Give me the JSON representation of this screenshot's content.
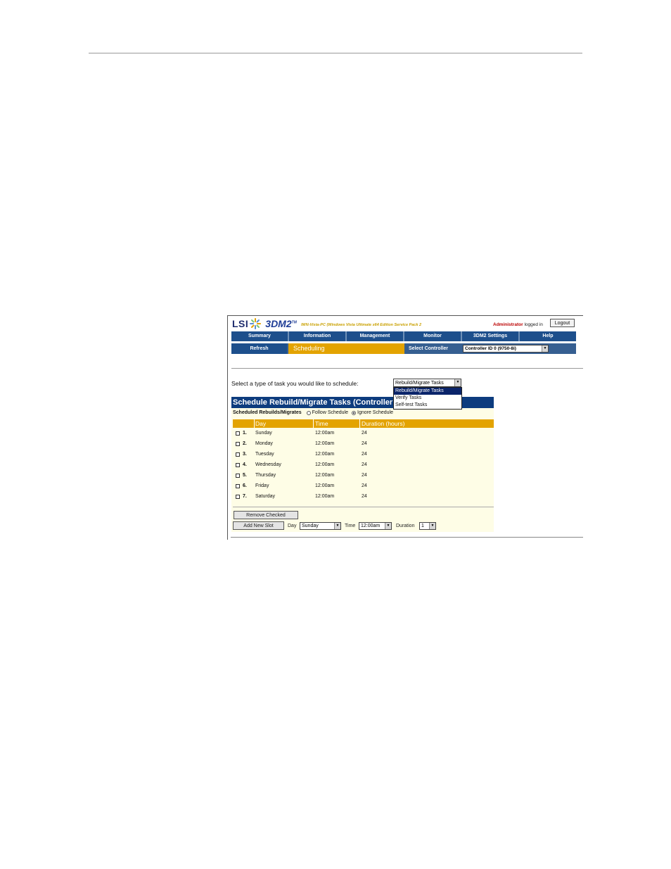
{
  "app": {
    "logo_lsi": "LSI",
    "logo_product": "3DM2",
    "logo_tm": "TM",
    "hostname": "IWN-Vista-PC (Windows Vista Ultimate x64 Edition Service Pack 2",
    "user": "Administrator",
    "logged_in": "logged in",
    "logout_label": "Logout"
  },
  "nav": {
    "items": [
      "Summary",
      "Information",
      "Management",
      "Monitor",
      "3DM2 Settings",
      "Help"
    ]
  },
  "subnav": {
    "refresh_label": "Refresh",
    "active_page": "Scheduling",
    "select_controller_label": "Select Controller",
    "controller_value": "Controller ID 0 (9750-8i)"
  },
  "task_type": {
    "prompt": "Select a type of task you would like to schedule:",
    "selected": "Rebuild/Migrate Tasks",
    "options": [
      "Rebuild/Migrate Tasks",
      "Verify Tasks",
      "Self-test Tasks"
    ]
  },
  "schedule": {
    "title": "Schedule Rebuild/Migrate Tasks (Controller ID 0)",
    "mode_label": "Scheduled Rebuilds/Migrates",
    "follow_label": "Follow Schedule",
    "ignore_label": "Ignore Schedule",
    "selected_mode": "Ignore Schedule",
    "columns": [
      "Day",
      "Time",
      "Duration (hours)"
    ],
    "rows": [
      {
        "num": "1.",
        "day": "Sunday",
        "time": "12:00am",
        "duration": "24"
      },
      {
        "num": "2.",
        "day": "Monday",
        "time": "12:00am",
        "duration": "24"
      },
      {
        "num": "3.",
        "day": "Tuesday",
        "time": "12:00am",
        "duration": "24"
      },
      {
        "num": "4.",
        "day": "Wednesday",
        "time": "12:00am",
        "duration": "24"
      },
      {
        "num": "5.",
        "day": "Thursday",
        "time": "12:00am",
        "duration": "24"
      },
      {
        "num": "6.",
        "day": "Friday",
        "time": "12:00am",
        "duration": "24"
      },
      {
        "num": "7.",
        "day": "Saturday",
        "time": "12:00am",
        "duration": "24"
      }
    ],
    "remove_label": "Remove Checked",
    "add_label": "Add New Slot",
    "day_label": "Day",
    "day_value": "Sunday",
    "time_label": "Time",
    "time_value": "12:00am",
    "duration_label": "Duration",
    "duration_value": "1"
  },
  "colors": {
    "nav_blue": "#1d4f8c",
    "accent_orange": "#e3a300",
    "title_navy": "#0d3c7e",
    "panel_cream": "#fefde6"
  }
}
